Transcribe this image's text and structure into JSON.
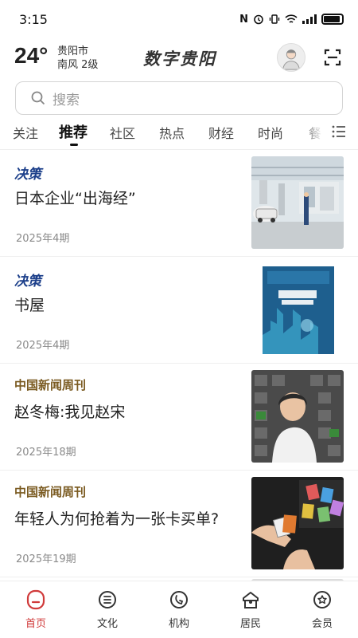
{
  "status_bar": {
    "time": "3:15",
    "nfc": "N",
    "battery_fill": 0.9
  },
  "header": {
    "temperature": "24°",
    "city": "贵阳市",
    "wind": "南风 2级",
    "app_title": "数字贵阳"
  },
  "search": {
    "placeholder": "搜索"
  },
  "tabs": [
    {
      "label": "关注"
    },
    {
      "label": "推荐",
      "active": true
    },
    {
      "label": "社区"
    },
    {
      "label": "热点"
    },
    {
      "label": "财经"
    },
    {
      "label": "时尚"
    },
    {
      "label": "餐"
    }
  ],
  "feed": [
    {
      "source": "决策",
      "title": "日本企业“出海经”",
      "date": "2025年4期",
      "thumb": "factory-photo"
    },
    {
      "source": "决策",
      "title": "书屋",
      "date": "2025年4期",
      "thumb": "magazine-cover"
    },
    {
      "source": "中国新闻周刊",
      "title": "赵冬梅:我见赵宋",
      "date": "2025年18期",
      "thumb": "portrait-photo"
    },
    {
      "source": "中国新闻周刊",
      "title": "年轻人为何抢着为一张卡买单?",
      "date": "2025年19期",
      "thumb": "cards-photo"
    }
  ],
  "bottom_nav": [
    {
      "label": "首页",
      "icon": "home-icon",
      "active": true
    },
    {
      "label": "文化",
      "icon": "culture-icon"
    },
    {
      "label": "机构",
      "icon": "institution-icon"
    },
    {
      "label": "居民",
      "icon": "resident-icon"
    },
    {
      "label": "会员",
      "icon": "member-icon"
    }
  ],
  "colors": {
    "accent": "#d03a3a",
    "jc_source": "#1c3f8a",
    "zg_source": "#7a5a20"
  }
}
